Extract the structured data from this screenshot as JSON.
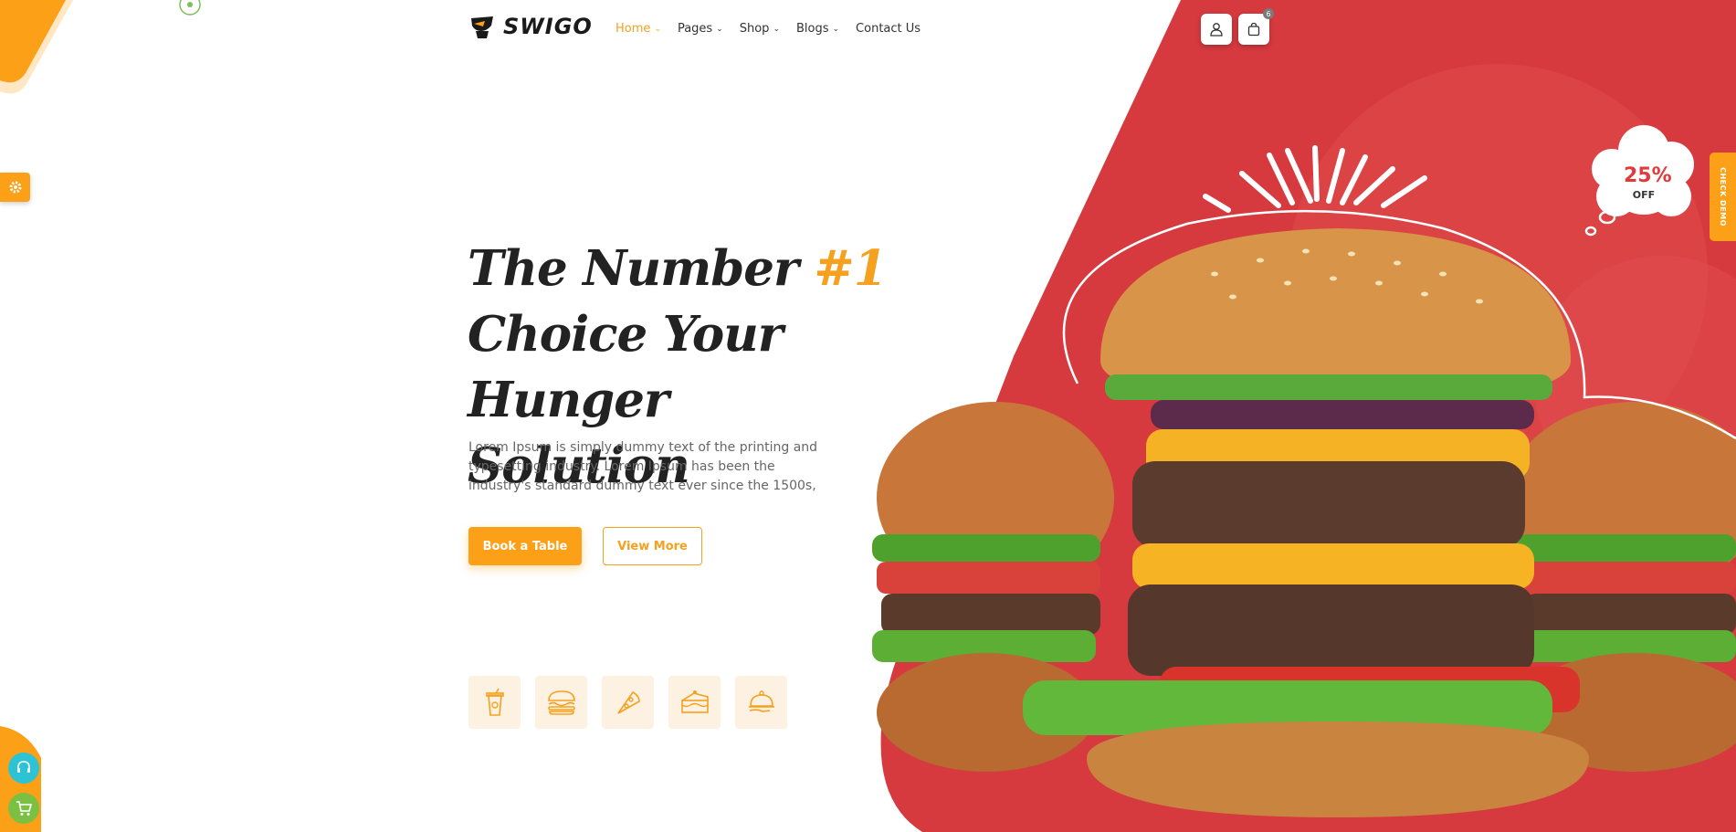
{
  "brand": {
    "name": "SWIGO",
    "accent_color": "#f5a11f",
    "hero_red": "#d63a3f"
  },
  "nav": {
    "items": [
      {
        "label": "Home",
        "has_dropdown": true,
        "active": true
      },
      {
        "label": "Pages",
        "has_dropdown": true,
        "active": false
      },
      {
        "label": "Shop",
        "has_dropdown": true,
        "active": false
      },
      {
        "label": "Blogs",
        "has_dropdown": true,
        "active": false
      },
      {
        "label": "Contact Us",
        "has_dropdown": false,
        "active": false
      }
    ],
    "cart_count": "6",
    "icons": [
      "user-icon",
      "shopping-bag-icon"
    ]
  },
  "hero": {
    "title_line1_a": "The Number ",
    "title_line1_b": "#1",
    "title_line2": "Choice Your Hunger",
    "title_line3": "Solution",
    "description": "Lorem Ipsum is simply dummy text of the printing and typesetting industry. Lorem Ipsum has been the industry's standard dummy text ever since the 1500s,",
    "primary_button": "Book a Table",
    "secondary_button": "View More",
    "categories": [
      "drink-icon",
      "burger-icon",
      "pizza-icon",
      "cake-icon",
      "serving-dish-icon"
    ]
  },
  "offer": {
    "percent": "25%",
    "label": "OFF"
  },
  "side": {
    "check_demo": "CHECK DEMO",
    "icons": [
      "gear-icon",
      "headset-icon",
      "cart-icon"
    ]
  }
}
